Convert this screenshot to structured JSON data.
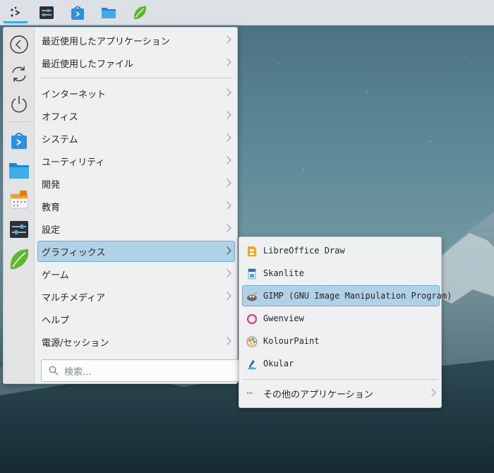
{
  "taskbar": {
    "items": [
      {
        "icon": "application-launcher-icon",
        "active": true
      },
      {
        "icon": "system-settings-icon"
      },
      {
        "icon": "discover-store-icon"
      },
      {
        "icon": "dolphin-folder-icon"
      },
      {
        "icon": "kate-leaf-icon"
      }
    ]
  },
  "sidebar": {
    "items": [
      {
        "icon": "back-arrow-icon"
      },
      {
        "icon": "refresh-icon"
      },
      {
        "icon": "power-icon"
      },
      {
        "icon": "discover-store-icon"
      },
      {
        "icon": "folder-icon"
      },
      {
        "icon": "calendar-icon"
      },
      {
        "icon": "system-settings-icon"
      },
      {
        "icon": "kate-leaf-icon"
      }
    ]
  },
  "menu": {
    "recent_apps": "最近使用したアプリケーション",
    "recent_files": "最近使用したファイル",
    "categories": [
      {
        "label": "インターネット",
        "has_sub": true
      },
      {
        "label": "オフィス",
        "has_sub": true
      },
      {
        "label": "システム",
        "has_sub": true
      },
      {
        "label": "ユーティリティ",
        "has_sub": true
      },
      {
        "label": "開発",
        "has_sub": true
      },
      {
        "label": "教育",
        "has_sub": true
      },
      {
        "label": "設定",
        "has_sub": true
      },
      {
        "label": "グラフィックス",
        "has_sub": true,
        "selected": true
      },
      {
        "label": "ゲーム",
        "has_sub": true
      },
      {
        "label": "マルチメディア",
        "has_sub": true
      },
      {
        "label": "ヘルプ",
        "has_sub": false
      },
      {
        "label": "電源/セッション",
        "has_sub": true
      }
    ],
    "search_placeholder": "検索..."
  },
  "submenu": {
    "items": [
      {
        "label": "LibreOffice Draw",
        "icon": "libreoffice-draw-icon"
      },
      {
        "label": "Skanlite",
        "icon": "scanner-icon"
      },
      {
        "label": "GIMP (GNU Image Manipulation Program)",
        "icon": "gimp-icon",
        "selected": true
      },
      {
        "label": "Gwenview",
        "icon": "gwenview-icon"
      },
      {
        "label": "KolourPaint",
        "icon": "kolourpaint-icon"
      },
      {
        "label": "Okular",
        "icon": "okular-icon"
      }
    ],
    "more_apps": "その他のアプリケーション",
    "more_icon": "more-dots-icon"
  },
  "colors": {
    "accent": "#3daee9",
    "selection": "#b0d2e6",
    "menu_bg": "#eff0f1"
  }
}
